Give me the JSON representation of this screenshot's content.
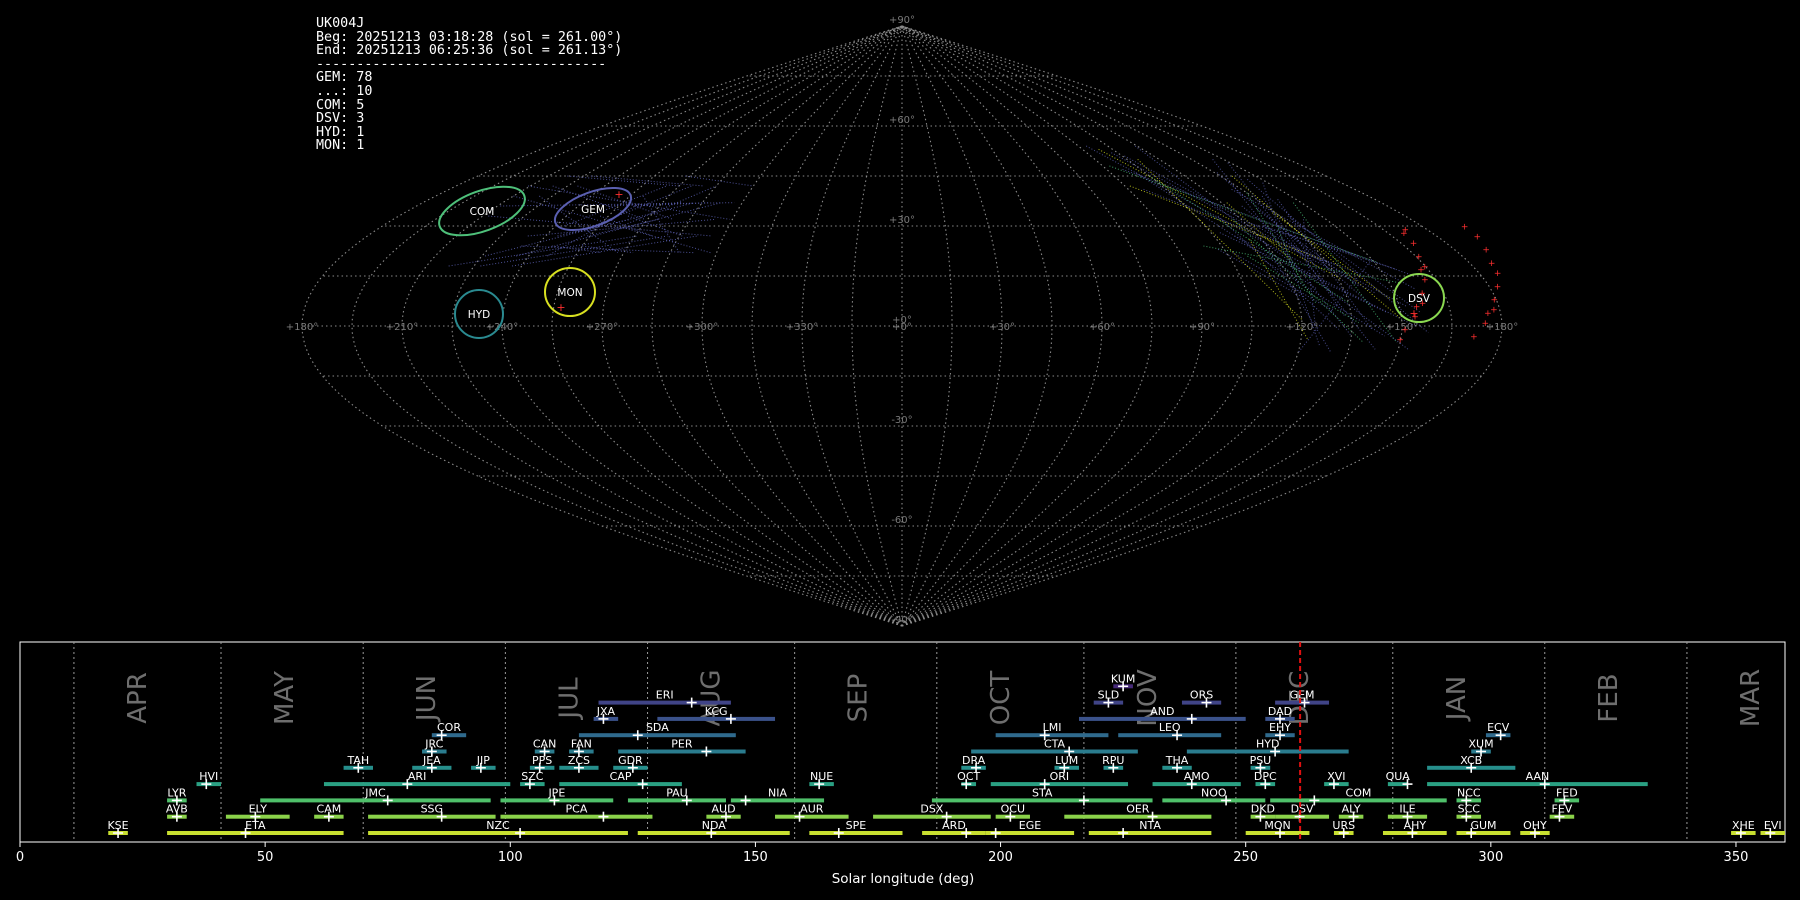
{
  "info": {
    "station": "UK004J",
    "begin": "Beg: 20251213 03:18:28 (sol = 261.00°)",
    "end": "End: 20251213 06:25:36 (sol = 261.13°)",
    "separator": "------------------------------------",
    "counts": [
      "GEM: 78",
      "...: 10",
      "COM: 5",
      "DSV: 3",
      "HYD: 1",
      "MON: 1"
    ]
  },
  "chart_data": [
    {
      "type": "scatter",
      "projection": "sinusoidal",
      "title": "",
      "lat_ticks": [
        "+90°",
        "+60°",
        "+30°",
        "+0°",
        "-30°",
        "-60°",
        "-90°"
      ],
      "lon_ticks": [
        "+180°",
        "+150°",
        "+120°",
        "+90°",
        "+60°",
        "+30°",
        "+0°",
        "+330°",
        "+300°",
        "+270°",
        "+240°",
        "+210°",
        "+180°"
      ],
      "radiants": [
        {
          "name": "COM",
          "ra": 132,
          "dec": 27,
          "color": "#4ec07a"
        },
        {
          "name": "GEM",
          "ra": 105,
          "dec": 30,
          "color": "#5a5fb0"
        },
        {
          "name": "MON",
          "ra": 102,
          "dec": 9,
          "color": "#d8e020"
        },
        {
          "name": "HYD",
          "ra": 128,
          "dec": 3,
          "color": "#2a8a90"
        },
        {
          "name": "DSV",
          "ra": 204,
          "dec": 7,
          "color": "#8ad850"
        }
      ]
    },
    {
      "type": "bar",
      "title": "",
      "xlabel": "Solar longitude (deg)",
      "ylabel": "",
      "xlim": [
        0,
        360
      ],
      "x_ticks": [
        0,
        50,
        100,
        150,
        200,
        250,
        300,
        350
      ],
      "grid": "vertical dotted month separators",
      "current_sol": 261.1,
      "months": [
        {
          "label": "APR",
          "start": 11
        },
        {
          "label": "MAY",
          "start": 41
        },
        {
          "label": "JUN",
          "start": 70
        },
        {
          "label": "JUL",
          "start": 99
        },
        {
          "label": "AUG",
          "start": 128
        },
        {
          "label": "SEP",
          "start": 158
        },
        {
          "label": "OCT",
          "start": 187
        },
        {
          "label": "NOV",
          "start": 217
        },
        {
          "label": "DEC",
          "start": 248
        },
        {
          "label": "JAN",
          "start": 280
        },
        {
          "label": "FEB",
          "start": 311
        },
        {
          "label": "MAR",
          "start": 340
        }
      ],
      "showers": [
        {
          "code": "KUM",
          "start": 223,
          "end": 227,
          "peak": 225,
          "row": 9
        },
        {
          "code": "ERI",
          "start": 118,
          "end": 145,
          "peak": 137,
          "row": 8
        },
        {
          "code": "SLD",
          "start": 219,
          "end": 225,
          "peak": 222,
          "row": 8
        },
        {
          "code": "ORS",
          "start": 237,
          "end": 245,
          "peak": 242,
          "row": 8
        },
        {
          "code": "GEM",
          "start": 256,
          "end": 267,
          "peak": 262,
          "row": 8
        },
        {
          "code": "JXA",
          "start": 117,
          "end": 122,
          "peak": 119,
          "row": 7
        },
        {
          "code": "KCG",
          "start": 130,
          "end": 154,
          "peak": 145,
          "row": 7
        },
        {
          "code": "AND",
          "start": 216,
          "end": 250,
          "peak": 239,
          "row": 7
        },
        {
          "code": "DAD",
          "start": 254,
          "end": 260,
          "peak": 257,
          "row": 7
        },
        {
          "code": "COR",
          "start": 84,
          "end": 91,
          "peak": 86,
          "row": 6
        },
        {
          "code": "SDA",
          "start": 114,
          "end": 146,
          "peak": 126,
          "row": 6
        },
        {
          "code": "LMI",
          "start": 199,
          "end": 222,
          "peak": 209,
          "row": 6
        },
        {
          "code": "LEO",
          "start": 224,
          "end": 245,
          "peak": 236,
          "row": 6
        },
        {
          "code": "EHY",
          "start": 254,
          "end": 260,
          "peak": 257,
          "row": 6
        },
        {
          "code": "ECV",
          "start": 299,
          "end": 304,
          "peak": 302,
          "row": 6
        },
        {
          "code": "JRC",
          "start": 82,
          "end": 87,
          "peak": 84,
          "row": 5
        },
        {
          "code": "CAN",
          "start": 105,
          "end": 109,
          "peak": 107,
          "row": 5
        },
        {
          "code": "FAN",
          "start": 112,
          "end": 117,
          "peak": 114,
          "row": 5
        },
        {
          "code": "PER",
          "start": 122,
          "end": 148,
          "peak": 140,
          "row": 5
        },
        {
          "code": "CTA",
          "start": 194,
          "end": 228,
          "peak": 214,
          "row": 5
        },
        {
          "code": "HYD",
          "start": 238,
          "end": 271,
          "peak": 256,
          "row": 5
        },
        {
          "code": "XUM",
          "start": 296,
          "end": 300,
          "peak": 298,
          "row": 5
        },
        {
          "code": "TAH",
          "start": 66,
          "end": 72,
          "peak": 69,
          "row": 4
        },
        {
          "code": "JEA",
          "start": 80,
          "end": 88,
          "peak": 84,
          "row": 4
        },
        {
          "code": "JIP",
          "start": 92,
          "end": 97,
          "peak": 94,
          "row": 4
        },
        {
          "code": "PPS",
          "start": 104,
          "end": 109,
          "peak": 106,
          "row": 4
        },
        {
          "code": "ZCS",
          "start": 110,
          "end": 118,
          "peak": 114,
          "row": 4
        },
        {
          "code": "GDR",
          "start": 121,
          "end": 128,
          "peak": 125,
          "row": 4
        },
        {
          "code": "DRA",
          "start": 192,
          "end": 197,
          "peak": 195,
          "row": 4
        },
        {
          "code": "LUM",
          "start": 211,
          "end": 216,
          "peak": 213,
          "row": 4
        },
        {
          "code": "RPU",
          "start": 221,
          "end": 225,
          "peak": 223,
          "row": 4
        },
        {
          "code": "THA",
          "start": 233,
          "end": 239,
          "peak": 236,
          "row": 4
        },
        {
          "code": "PSU",
          "start": 251,
          "end": 255,
          "peak": 253,
          "row": 4
        },
        {
          "code": "XCB",
          "start": 287,
          "end": 305,
          "peak": 296,
          "row": 4
        },
        {
          "code": "HVI",
          "start": 36,
          "end": 41,
          "peak": 38,
          "row": 3
        },
        {
          "code": "ARI",
          "start": 62,
          "end": 100,
          "peak": 79,
          "row": 3
        },
        {
          "code": "SZC",
          "start": 102,
          "end": 107,
          "peak": 104,
          "row": 3
        },
        {
          "code": "CAP",
          "start": 110,
          "end": 135,
          "peak": 127,
          "row": 3
        },
        {
          "code": "NUE",
          "start": 161,
          "end": 166,
          "peak": 163,
          "row": 3
        },
        {
          "code": "OCT",
          "start": 192,
          "end": 195,
          "peak": 193,
          "row": 3
        },
        {
          "code": "ORI",
          "start": 198,
          "end": 226,
          "peak": 209,
          "row": 3
        },
        {
          "code": "AMO",
          "start": 231,
          "end": 249,
          "peak": 239,
          "row": 3
        },
        {
          "code": "DPC",
          "start": 252,
          "end": 256,
          "peak": 254,
          "row": 3
        },
        {
          "code": "XVI",
          "start": 266,
          "end": 271,
          "peak": 268,
          "row": 3
        },
        {
          "code": "QUA",
          "start": 279,
          "end": 283,
          "peak": 283,
          "row": 3
        },
        {
          "code": "AAN",
          "start": 287,
          "end": 332,
          "peak": 311,
          "row": 3
        },
        {
          "code": "LYR",
          "start": 30,
          "end": 34,
          "peak": 32,
          "row": 2
        },
        {
          "code": "JMC",
          "start": 49,
          "end": 96,
          "peak": 75,
          "row": 2
        },
        {
          "code": "JPE",
          "start": 98,
          "end": 121,
          "peak": 109,
          "row": 2
        },
        {
          "code": "PAU",
          "start": 124,
          "end": 144,
          "peak": 136,
          "row": 2
        },
        {
          "code": "NIA",
          "start": 145,
          "end": 164,
          "peak": 148,
          "row": 2
        },
        {
          "code": "STA",
          "start": 186,
          "end": 231,
          "peak": 217,
          "row": 2
        },
        {
          "code": "NOO",
          "start": 233,
          "end": 254,
          "peak": 246,
          "row": 2
        },
        {
          "code": "COM",
          "start": 255,
          "end": 291,
          "peak": 264,
          "row": 2
        },
        {
          "code": "NCC",
          "start": 293,
          "end": 298,
          "peak": 295,
          "row": 2
        },
        {
          "code": "FED",
          "start": 313,
          "end": 318,
          "peak": 315,
          "row": 2
        },
        {
          "code": "AVB",
          "start": 30,
          "end": 34,
          "peak": 32,
          "row": 1
        },
        {
          "code": "ELY",
          "start": 42,
          "end": 55,
          "peak": 48,
          "row": 1
        },
        {
          "code": "CAM",
          "start": 60,
          "end": 66,
          "peak": 63,
          "row": 1
        },
        {
          "code": "SSG",
          "start": 71,
          "end": 97,
          "peak": 86,
          "row": 1
        },
        {
          "code": "PCA",
          "start": 98,
          "end": 129,
          "peak": 119,
          "row": 1
        },
        {
          "code": "AUD",
          "start": 140,
          "end": 147,
          "peak": 144,
          "row": 1
        },
        {
          "code": "AUR",
          "start": 154,
          "end": 169,
          "peak": 159,
          "row": 1
        },
        {
          "code": "DSX",
          "start": 174,
          "end": 198,
          "peak": 189,
          "row": 1
        },
        {
          "code": "OCU",
          "start": 199,
          "end": 206,
          "peak": 202,
          "row": 1
        },
        {
          "code": "OER",
          "start": 213,
          "end": 243,
          "peak": 231,
          "row": 1
        },
        {
          "code": "DKD",
          "start": 251,
          "end": 256,
          "peak": 253,
          "row": 1
        },
        {
          "code": "DSV",
          "start": 256,
          "end": 267,
          "peak": 261,
          "row": 1
        },
        {
          "code": "ALY",
          "start": 269,
          "end": 274,
          "peak": 272,
          "row": 1
        },
        {
          "code": "ILE",
          "start": 279,
          "end": 287,
          "peak": 283,
          "row": 1
        },
        {
          "code": "SCC",
          "start": 293,
          "end": 298,
          "peak": 295,
          "row": 1
        },
        {
          "code": "FEV",
          "start": 312,
          "end": 317,
          "peak": 314,
          "row": 1
        },
        {
          "code": "KSE",
          "start": 18,
          "end": 22,
          "peak": 20,
          "row": 0
        },
        {
          "code": "ETA",
          "start": 30,
          "end": 66,
          "peak": 46,
          "row": 0
        },
        {
          "code": "NZC",
          "start": 71,
          "end": 124,
          "peak": 102,
          "row": 0
        },
        {
          "code": "NDA",
          "start": 126,
          "end": 157,
          "peak": 141,
          "row": 0
        },
        {
          "code": "SPE",
          "start": 161,
          "end": 180,
          "peak": 167,
          "row": 0
        },
        {
          "code": "ARD",
          "start": 184,
          "end": 197,
          "peak": 193,
          "row": 0
        },
        {
          "code": "EGE",
          "start": 197,
          "end": 215,
          "peak": 199,
          "row": 0
        },
        {
          "code": "NTA",
          "start": 218,
          "end": 243,
          "peak": 225,
          "row": 0
        },
        {
          "code": "MON",
          "start": 250,
          "end": 263,
          "peak": 257,
          "row": 0
        },
        {
          "code": "URS",
          "start": 268,
          "end": 272,
          "peak": 270,
          "row": 0
        },
        {
          "code": "AHY",
          "start": 278,
          "end": 291,
          "peak": 284,
          "row": 0
        },
        {
          "code": "GUM",
          "start": 293,
          "end": 304,
          "peak": 296,
          "row": 0
        },
        {
          "code": "OHY",
          "start": 306,
          "end": 312,
          "peak": 309,
          "row": 0
        },
        {
          "code": "XHE",
          "start": 349,
          "end": 354,
          "peak": 351,
          "row": 0
        },
        {
          "code": "EVI",
          "start": 355,
          "end": 360,
          "peak": 357,
          "row": 0
        }
      ]
    }
  ]
}
